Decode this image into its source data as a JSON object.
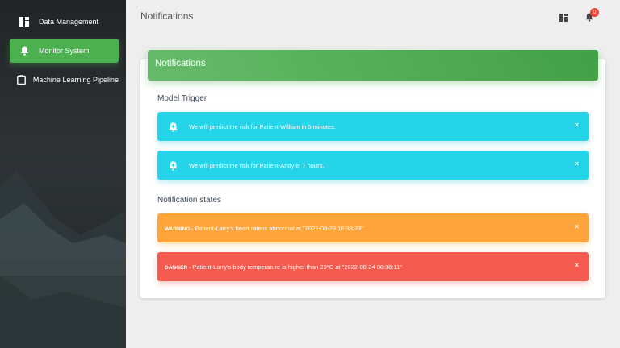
{
  "sidebar": {
    "items": [
      {
        "label": "Data Management",
        "icon": "dashboard-icon",
        "active": false
      },
      {
        "label": "Monitor System",
        "icon": "bell-icon",
        "active": true
      },
      {
        "label": "Machine Learning Pipeline",
        "icon": "clipboard-icon",
        "active": false
      }
    ]
  },
  "header": {
    "title": "Notifications",
    "notification_count": "0"
  },
  "card": {
    "title": "Notifications",
    "model_trigger_title": "Model Trigger",
    "model_trigger_alerts": [
      {
        "text": "We will predict the risk for Patient-William in 5 minutes.",
        "close": "×"
      },
      {
        "text": "We will predict the risk for Patient-Andy in 7 hours.",
        "close": "×"
      }
    ],
    "states_title": "Notification states",
    "state_alerts": [
      {
        "type": "WARNING -",
        "text": "Patient-Larry's heart rate is abnormal at \"2022-08-23 16:33:23\"",
        "close": "×"
      },
      {
        "type": "DANGER -",
        "text": "Patient-Larry's body temperature is higher than 39°C at \"2022-08-24 08:30:11\"",
        "close": "×"
      }
    ]
  },
  "colors": {
    "success": "#4caf50",
    "info": "#26d4ea",
    "warning": "#ffa43a",
    "danger": "#f55a4e",
    "badge": "#f44336"
  }
}
